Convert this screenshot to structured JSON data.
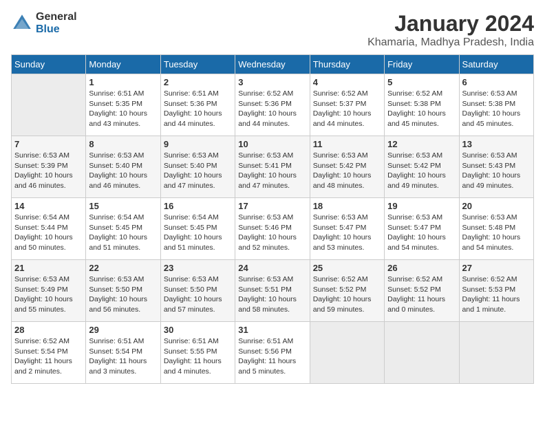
{
  "header": {
    "logo_general": "General",
    "logo_blue": "Blue",
    "title": "January 2024",
    "subtitle": "Khamaria, Madhya Pradesh, India"
  },
  "days_of_week": [
    "Sunday",
    "Monday",
    "Tuesday",
    "Wednesday",
    "Thursday",
    "Friday",
    "Saturday"
  ],
  "weeks": [
    [
      {
        "day": "",
        "info": ""
      },
      {
        "day": "1",
        "info": "Sunrise: 6:51 AM\nSunset: 5:35 PM\nDaylight: 10 hours\nand 43 minutes."
      },
      {
        "day": "2",
        "info": "Sunrise: 6:51 AM\nSunset: 5:36 PM\nDaylight: 10 hours\nand 44 minutes."
      },
      {
        "day": "3",
        "info": "Sunrise: 6:52 AM\nSunset: 5:36 PM\nDaylight: 10 hours\nand 44 minutes."
      },
      {
        "day": "4",
        "info": "Sunrise: 6:52 AM\nSunset: 5:37 PM\nDaylight: 10 hours\nand 44 minutes."
      },
      {
        "day": "5",
        "info": "Sunrise: 6:52 AM\nSunset: 5:38 PM\nDaylight: 10 hours\nand 45 minutes."
      },
      {
        "day": "6",
        "info": "Sunrise: 6:53 AM\nSunset: 5:38 PM\nDaylight: 10 hours\nand 45 minutes."
      }
    ],
    [
      {
        "day": "7",
        "info": "Sunrise: 6:53 AM\nSunset: 5:39 PM\nDaylight: 10 hours\nand 46 minutes."
      },
      {
        "day": "8",
        "info": "Sunrise: 6:53 AM\nSunset: 5:40 PM\nDaylight: 10 hours\nand 46 minutes."
      },
      {
        "day": "9",
        "info": "Sunrise: 6:53 AM\nSunset: 5:40 PM\nDaylight: 10 hours\nand 47 minutes."
      },
      {
        "day": "10",
        "info": "Sunrise: 6:53 AM\nSunset: 5:41 PM\nDaylight: 10 hours\nand 47 minutes."
      },
      {
        "day": "11",
        "info": "Sunrise: 6:53 AM\nSunset: 5:42 PM\nDaylight: 10 hours\nand 48 minutes."
      },
      {
        "day": "12",
        "info": "Sunrise: 6:53 AM\nSunset: 5:42 PM\nDaylight: 10 hours\nand 49 minutes."
      },
      {
        "day": "13",
        "info": "Sunrise: 6:53 AM\nSunset: 5:43 PM\nDaylight: 10 hours\nand 49 minutes."
      }
    ],
    [
      {
        "day": "14",
        "info": "Sunrise: 6:54 AM\nSunset: 5:44 PM\nDaylight: 10 hours\nand 50 minutes."
      },
      {
        "day": "15",
        "info": "Sunrise: 6:54 AM\nSunset: 5:45 PM\nDaylight: 10 hours\nand 51 minutes."
      },
      {
        "day": "16",
        "info": "Sunrise: 6:54 AM\nSunset: 5:45 PM\nDaylight: 10 hours\nand 51 minutes."
      },
      {
        "day": "17",
        "info": "Sunrise: 6:53 AM\nSunset: 5:46 PM\nDaylight: 10 hours\nand 52 minutes."
      },
      {
        "day": "18",
        "info": "Sunrise: 6:53 AM\nSunset: 5:47 PM\nDaylight: 10 hours\nand 53 minutes."
      },
      {
        "day": "19",
        "info": "Sunrise: 6:53 AM\nSunset: 5:47 PM\nDaylight: 10 hours\nand 54 minutes."
      },
      {
        "day": "20",
        "info": "Sunrise: 6:53 AM\nSunset: 5:48 PM\nDaylight: 10 hours\nand 54 minutes."
      }
    ],
    [
      {
        "day": "21",
        "info": "Sunrise: 6:53 AM\nSunset: 5:49 PM\nDaylight: 10 hours\nand 55 minutes."
      },
      {
        "day": "22",
        "info": "Sunrise: 6:53 AM\nSunset: 5:50 PM\nDaylight: 10 hours\nand 56 minutes."
      },
      {
        "day": "23",
        "info": "Sunrise: 6:53 AM\nSunset: 5:50 PM\nDaylight: 10 hours\nand 57 minutes."
      },
      {
        "day": "24",
        "info": "Sunrise: 6:53 AM\nSunset: 5:51 PM\nDaylight: 10 hours\nand 58 minutes."
      },
      {
        "day": "25",
        "info": "Sunrise: 6:52 AM\nSunset: 5:52 PM\nDaylight: 10 hours\nand 59 minutes."
      },
      {
        "day": "26",
        "info": "Sunrise: 6:52 AM\nSunset: 5:52 PM\nDaylight: 11 hours\nand 0 minutes."
      },
      {
        "day": "27",
        "info": "Sunrise: 6:52 AM\nSunset: 5:53 PM\nDaylight: 11 hours\nand 1 minute."
      }
    ],
    [
      {
        "day": "28",
        "info": "Sunrise: 6:52 AM\nSunset: 5:54 PM\nDaylight: 11 hours\nand 2 minutes."
      },
      {
        "day": "29",
        "info": "Sunrise: 6:51 AM\nSunset: 5:54 PM\nDaylight: 11 hours\nand 3 minutes."
      },
      {
        "day": "30",
        "info": "Sunrise: 6:51 AM\nSunset: 5:55 PM\nDaylight: 11 hours\nand 4 minutes."
      },
      {
        "day": "31",
        "info": "Sunrise: 6:51 AM\nSunset: 5:56 PM\nDaylight: 11 hours\nand 5 minutes."
      },
      {
        "day": "",
        "info": ""
      },
      {
        "day": "",
        "info": ""
      },
      {
        "day": "",
        "info": ""
      }
    ]
  ]
}
